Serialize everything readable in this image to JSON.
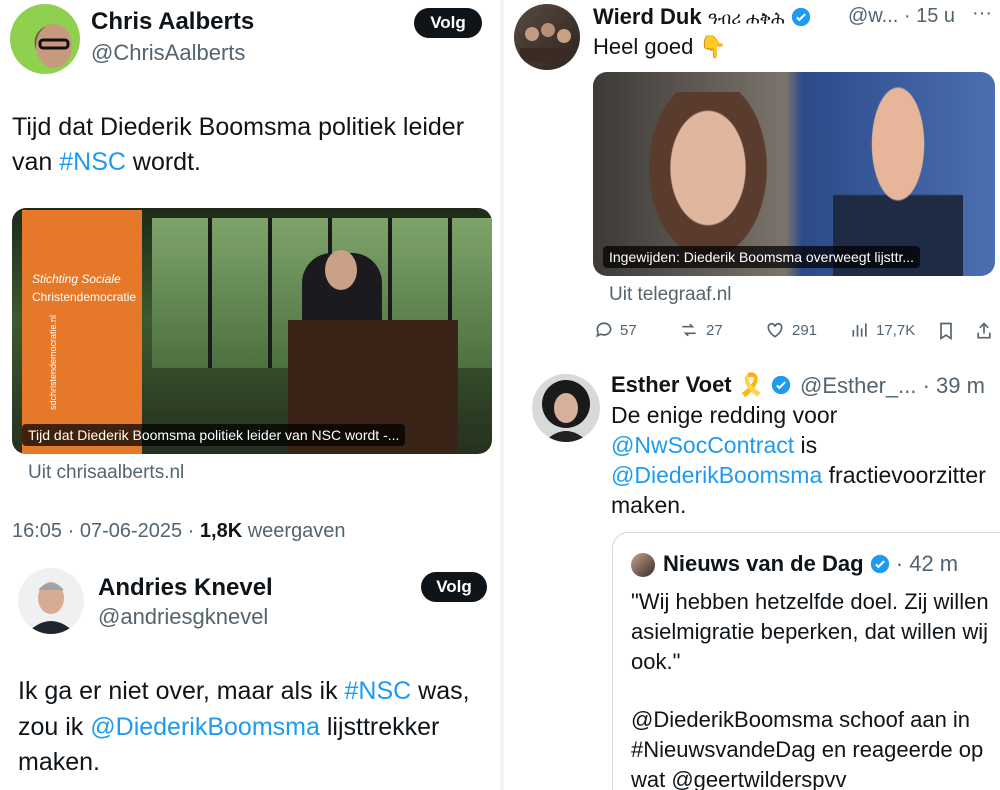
{
  "left": {
    "tweet1": {
      "name": "Chris Aalberts",
      "handle": "@ChrisAalberts",
      "follow_label": "Volg",
      "text_before": "Tijd dat Diederik Boomsma politiek leider van ",
      "hashtag": "#NSC",
      "text_after": " wordt.",
      "card_caption": "Tijd dat Diederik Boomsma politiek leider van NSC wordt -...",
      "banner_line1": "Stichting Sociale",
      "banner_line2": "Christendemocratie",
      "banner_url": "sdchristendemocratie.nl",
      "card_source": "Uit chrisaalberts.nl",
      "time": "16:05 · 07-06-2025 · ",
      "views_count": "1,8K",
      "views_label": " weergaven"
    },
    "tweet2": {
      "name": "Andries Knevel",
      "handle": "@andriesgknevel",
      "follow_label": "Volg",
      "text_part1": "Ik ga er niet over, maar als ik ",
      "hashtag": "#NSC",
      "text_part2": " was, zou ik ",
      "mention": "@DiederikBoomsma",
      "text_part3": " lijsttrekker maken."
    }
  },
  "right": {
    "tweet3": {
      "name": "Wierd Duk",
      "name_suffix": "ዓብሪ ሐቅሕ",
      "handle_time": "@w... · 15 u",
      "text": "Heel goed 👇",
      "card_caption": "Ingewijden: Diederik Boomsma overweegt lijsttr...",
      "card_source": "Uit telegraaf.nl",
      "replies": "57",
      "retweets": "27",
      "likes": "291",
      "views": "17,7K"
    },
    "tweet4": {
      "name": "Esther Voet",
      "emoji": "🎗️",
      "handle_time": "@Esther_... · 39 m",
      "text_line1": "De enige redding voor",
      "mention1": "@NwSocContract",
      "text_is": " is",
      "mention2": "@DiederikBoomsma",
      "text_end": " fractievoorzitter maken.",
      "quote": {
        "name": "Nieuws van de Dag",
        "time": "· 42 m",
        "text1": "\"Wij hebben hetzelfde doel. Zij willen asielmigratie beperken, dat willen wij ook.\"",
        "text2": "@DiederikBoomsma schoof aan in #NieuwsvandeDag en reageerde op wat @geertwilderspvv"
      }
    }
  },
  "colors": {
    "link": "#1d9bf0",
    "verified": "#1d9bf0",
    "muted": "#536471",
    "button": "#0f1419"
  }
}
